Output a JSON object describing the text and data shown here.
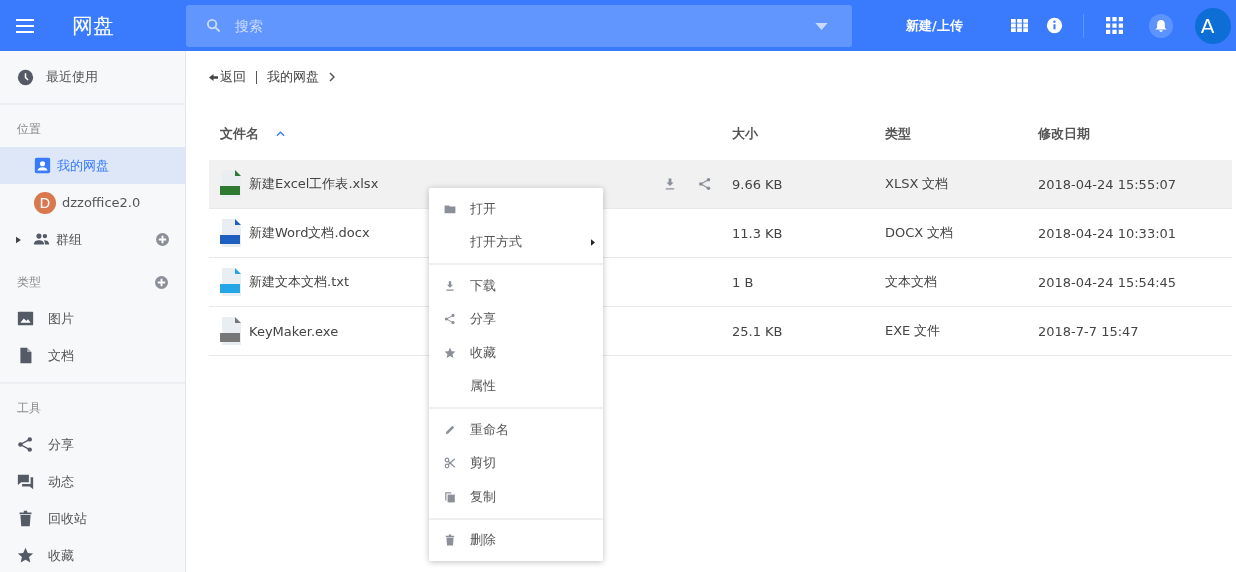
{
  "header": {
    "title": "网盘",
    "search": {
      "placeholder": "搜索"
    },
    "new_button": "新建/上传",
    "avatar_letter": "A"
  },
  "sidebar": {
    "top": [
      {
        "label": "最近使用",
        "kind": "clock",
        "selected": false
      }
    ],
    "sections": [
      {
        "title": "位置",
        "add": false,
        "items": [
          {
            "label": "我的网盘",
            "kind": "user",
            "selected": true
          },
          {
            "label": "dzzoffice2.0",
            "kind": "avatar",
            "avatar_letter": "D",
            "selected": false
          },
          {
            "label": "群组",
            "kind": "group",
            "expanded": false,
            "add": true,
            "selected": false
          }
        ]
      },
      {
        "title": "类型",
        "add": true,
        "items": [
          {
            "label": "图片",
            "kind": "image",
            "selected": false
          },
          {
            "label": "文档",
            "kind": "document",
            "selected": false
          }
        ]
      },
      {
        "title": "工具",
        "add": false,
        "items": [
          {
            "label": "分享",
            "kind": "share",
            "selected": false
          },
          {
            "label": "动态",
            "kind": "chat",
            "selected": false
          },
          {
            "label": "回收站",
            "kind": "trash",
            "selected": false
          },
          {
            "label": "收藏",
            "kind": "star",
            "selected": false
          }
        ]
      }
    ]
  },
  "breadcrumb": {
    "back": "返回",
    "path": [
      "我的网盘"
    ]
  },
  "table": {
    "columns": [
      {
        "label": "文件名",
        "sorted": true
      },
      {
        "label": "大小",
        "sorted": false
      },
      {
        "label": "类型",
        "sorted": false
      },
      {
        "label": "修改日期",
        "sorted": false
      }
    ],
    "rows": [
      {
        "name": "新建Excel工作表.xlsx",
        "color": "#2f7a32",
        "size": "9.66 KB",
        "type": "XLSX 文档",
        "modified": "2018-04-24 15:55:07",
        "hovered": true
      },
      {
        "name": "新建Word文档.docx",
        "color": "#1f5fbf",
        "size": "11.3 KB",
        "type": "DOCX 文档",
        "modified": "2018-04-24 10:33:01",
        "hovered": false
      },
      {
        "name": "新建文本文档.txt",
        "color": "#23a5e6",
        "size": "1 B",
        "type": "文本文档",
        "modified": "2018-04-24 15:54:45",
        "hovered": false
      },
      {
        "name": "KeyMaker.exe",
        "color": "#777777",
        "size": "25.1 KB",
        "type": "EXE 文件",
        "modified": "2018-7-7 15:47",
        "hovered": false
      }
    ]
  },
  "context_menu": {
    "groups": [
      {
        "items": [
          {
            "label": "打开",
            "kind": "folder",
            "submenu": false
          },
          {
            "label": "打开方式",
            "kind": "none",
            "submenu": true
          }
        ]
      },
      {
        "items": [
          {
            "label": "下载",
            "kind": "download",
            "submenu": false
          },
          {
            "label": "分享",
            "kind": "share",
            "submenu": false
          },
          {
            "label": "收藏",
            "kind": "star",
            "submenu": false
          },
          {
            "label": "属性",
            "kind": "none",
            "submenu": false
          }
        ]
      },
      {
        "items": [
          {
            "label": "重命名",
            "kind": "pencil",
            "submenu": false
          },
          {
            "label": "剪切",
            "kind": "scissors",
            "submenu": false
          },
          {
            "label": "复制",
            "kind": "copy",
            "submenu": false
          }
        ]
      },
      {
        "items": [
          {
            "label": "删除",
            "kind": "trash",
            "submenu": false
          }
        ]
      }
    ]
  }
}
